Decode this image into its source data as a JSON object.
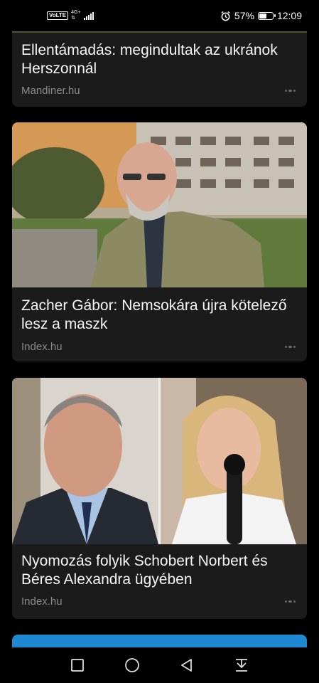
{
  "status_bar": {
    "volte": "VoLTE",
    "network": "4G+",
    "battery_percent": "57%",
    "battery_level": 0.57,
    "time": "12:09"
  },
  "articles": [
    {
      "title": "Ellentámadás: megindultak az ukránok Herszonnál",
      "source": "Mandiner.hu"
    },
    {
      "title": "Zacher Gábor: Nemsokára újra kötelező lesz a maszk",
      "source": "Index.hu"
    },
    {
      "title": "Nyomozás folyik Schobert Norbert és Béres Alexandra ügyében",
      "source": "Index.hu"
    }
  ],
  "colors": {
    "card_bg": "#1b1b1b",
    "source_text": "#8a8a8a",
    "next_card_accent": "#1e88d0"
  },
  "nav_bar": {
    "icons": [
      "recent-apps-icon",
      "home-icon",
      "back-icon",
      "notification-pull-icon"
    ]
  }
}
